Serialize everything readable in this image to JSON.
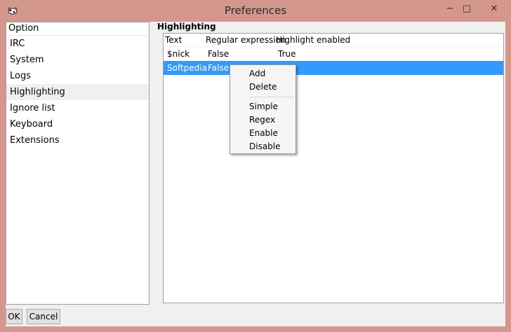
{
  "window": {
    "title": "Preferences",
    "minimize_glyph": "−",
    "maximize_glyph": "□",
    "close_glyph": "✕"
  },
  "sidebar": {
    "header": "Option",
    "items": [
      "IRC",
      "System",
      "Logs",
      "Highlighting",
      "Ignore list",
      "Keyboard",
      "Extensions"
    ],
    "selected": "Highlighting"
  },
  "main": {
    "section_title": "Highlighting",
    "columns": [
      "Text",
      "Regular expression",
      "Highlight enabled"
    ],
    "rows": [
      {
        "text": "$nick",
        "regex": "False",
        "enabled": "True"
      },
      {
        "text": "Softpedia",
        "regex": "False",
        "enabled": ""
      }
    ],
    "selected_row": 1
  },
  "context_menu": {
    "items": [
      "Add",
      "Delete",
      "Simple",
      "Regex",
      "Enable",
      "Disable"
    ]
  },
  "buttons": {
    "ok": "OK",
    "cancel": "Cancel"
  },
  "colors": {
    "frame": "#d3988b",
    "selection": "#3399ff"
  }
}
